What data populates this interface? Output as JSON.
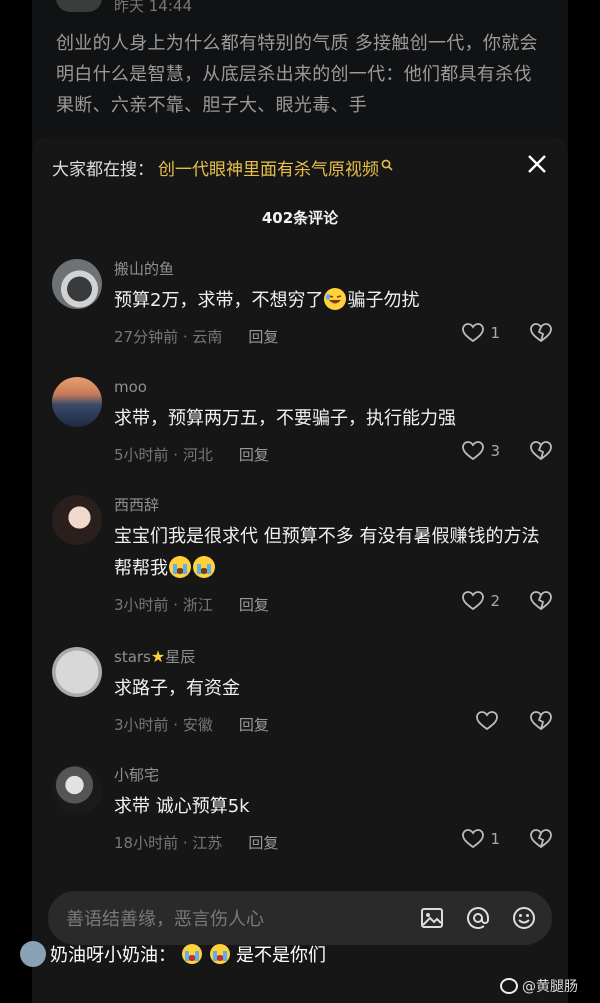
{
  "post": {
    "time": "昨天 14:44",
    "text": "创业的人身上为什么都有特别的气质 多接触创一代，你就会明白什么是智慧，从底层杀出来的创一代：他们都具有杀伐果断、六亲不靠、胆子大、眼光毒、手"
  },
  "search": {
    "prefix": "大家都在搜：",
    "query": "创一代眼神里面有杀气原视频"
  },
  "comment_count": "402条评论",
  "comments": [
    {
      "name": "搬山的鱼",
      "text_a": "预算2万，求带，不想穷了",
      "text_b": "骗子勿扰",
      "time": "27分钟前 · 云南",
      "reply": "回复",
      "likes": "1"
    },
    {
      "name": "moo",
      "text": "求带，预算两万五，不要骗子，执行能力强",
      "time": "5小时前 · 河北",
      "reply": "回复",
      "likes": "3"
    },
    {
      "name": "西西辞",
      "text": "宝宝们我是很求代 但预算不多 有没有暑假赚钱的方法帮帮我",
      "time": "3小时前 · 浙江",
      "reply": "回复",
      "likes": "2"
    },
    {
      "name_a": "stars",
      "name_b": "星辰",
      "text": "求路子，有资金",
      "time": "3小时前 · 安徽",
      "reply": "回复",
      "likes": ""
    },
    {
      "name": "小郁宅",
      "text": "求带 诚心预算5k",
      "time": "18小时前 · 江苏",
      "reply": "回复",
      "likes": "1"
    }
  ],
  "input": {
    "placeholder": "善语结善缘，恶言伤人心"
  },
  "danmaku": {
    "name": "奶油呀小奶油：",
    "text": "是不是你们"
  },
  "watermark": "@黄腿肠",
  "colors": {
    "accent": "#e7c04a",
    "sheet": "#161616",
    "background": "#000000"
  }
}
